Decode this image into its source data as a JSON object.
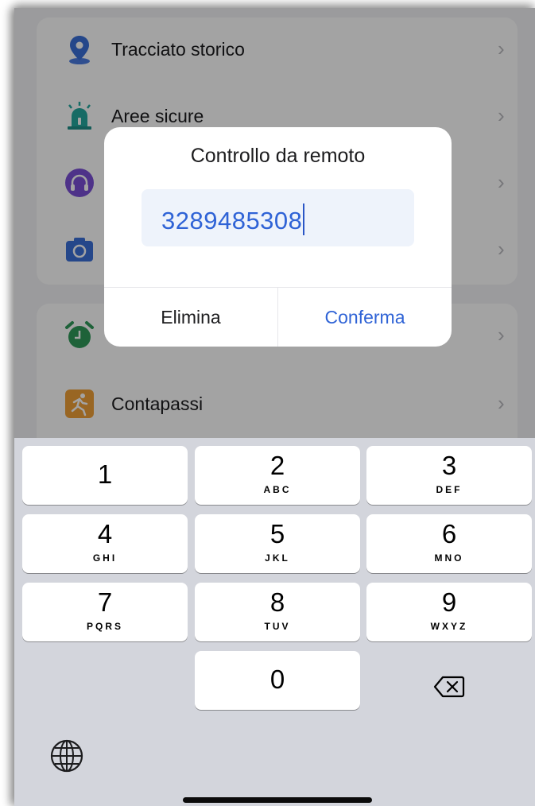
{
  "menu": {
    "items": [
      {
        "label": "Tracciato storico",
        "icon": "location-pin-icon"
      },
      {
        "label": "Aree sicure",
        "icon": "alarm-light-icon"
      },
      {
        "label": "",
        "icon": "headset-icon"
      },
      {
        "label": "",
        "icon": "camera-icon"
      },
      {
        "label": "",
        "icon": "alarm-clock-icon"
      },
      {
        "label": "Contapassi",
        "icon": "running-person-icon"
      }
    ]
  },
  "dialog": {
    "title": "Controllo da remoto",
    "input_value": "3289485308",
    "cancel_label": "Elimina",
    "confirm_label": "Conferma"
  },
  "keyboard": {
    "keys": [
      {
        "digit": "1",
        "letters": ""
      },
      {
        "digit": "2",
        "letters": "ABC"
      },
      {
        "digit": "3",
        "letters": "DEF"
      },
      {
        "digit": "4",
        "letters": "GHI"
      },
      {
        "digit": "5",
        "letters": "JKL"
      },
      {
        "digit": "6",
        "letters": "MNO"
      },
      {
        "digit": "7",
        "letters": "PQRS"
      },
      {
        "digit": "8",
        "letters": "TUV"
      },
      {
        "digit": "9",
        "letters": "WXYZ"
      },
      {
        "digit": "0",
        "letters": ""
      }
    ],
    "delete_icon": "backspace-icon",
    "globe_icon": "globe-icon"
  },
  "colors": {
    "accent": "#2f63d6",
    "keyboard_bg": "#d3d5dc",
    "screen_bg": "#f2f3f6"
  }
}
